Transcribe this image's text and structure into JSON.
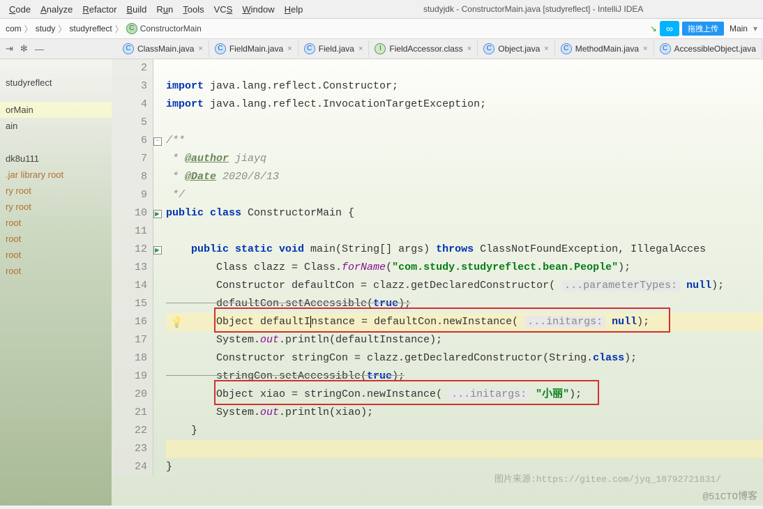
{
  "menu": {
    "items": [
      "Code",
      "Analyze",
      "Refactor",
      "Build",
      "Run",
      "Tools",
      "VCS",
      "Window",
      "Help"
    ],
    "underlines": [
      "C",
      "A",
      "R",
      "B",
      "R",
      "T",
      "V",
      "W",
      "H"
    ]
  },
  "title": "studyjdk - ConstructorMain.java [studyreflect] - IntelliJ IDEA",
  "crumbs": [
    "com",
    "study",
    "studyreflect",
    "ConstructorMain"
  ],
  "crumbs_file_icon": "C",
  "upload_label": "拖拽上传",
  "right_combo": "Main",
  "tabs": [
    {
      "icon": "C",
      "cls": "fc",
      "label": "ClassMain.java"
    },
    {
      "icon": "C",
      "cls": "fc",
      "label": "FieldMain.java"
    },
    {
      "icon": "C",
      "cls": "fc",
      "label": "Field.java"
    },
    {
      "icon": "I",
      "cls": "fi",
      "label": "FieldAccessor.class"
    },
    {
      "icon": "C",
      "cls": "fc",
      "label": "Object.java"
    },
    {
      "icon": "C",
      "cls": "fc",
      "label": "MethodMain.java"
    },
    {
      "icon": "C",
      "cls": "fc",
      "label": "AccessibleObject.java"
    }
  ],
  "sidebar": {
    "items": [
      "",
      "",
      "studyreflect",
      "",
      "",
      "orMain",
      "ain",
      "",
      "",
      "",
      "dk8u111",
      ".jar library root",
      "ry root",
      "ry root",
      " root",
      " root",
      " root",
      "root"
    ]
  },
  "gutter_start": 2,
  "gutter_end": 24,
  "code": {
    "l2": "",
    "l3a": "import",
    "l3b": " java.lang.reflect.Constructor;",
    "l4a": "import",
    "l4b": " java.lang.reflect.InvocationTargetException;",
    "l5": "",
    "l6": "/**",
    "l7a": " * ",
    "l7tag": "@author",
    "l7b": " jiayq",
    "l8a": " * ",
    "l8tag": "@Date",
    "l8b": " 2020/8/13",
    "l9": " */",
    "l10a": "public class",
    "l10b": " ConstructorMain {",
    "l11": "",
    "l12a": "    public static void",
    "l12b": " main(String[] args) ",
    "l12c": "throws",
    "l12d": " ClassNotFoundException, IllegalAcces",
    "l13a": "        Class clazz = Class.",
    "l13b": "forName",
    "l13c": "(",
    "l13s": "\"com.study.studyreflect.bean.People\"",
    "l13d": ");",
    "l14a": "        Constructor defaultCon = clazz.getDeclaredConstructor( ",
    "l14h": "...parameterTypes:",
    "l14b": " ",
    "l14n": "null",
    "l14c": ");",
    "l15a": "        defaultCon.setAccessible(",
    "l15b": "true",
    "l15c": ");",
    "l16a": "        Object defaultI",
    "l16b": "nstance = defaultCon.newInstance( ",
    "l16h": "...initargs:",
    "l16c": " ",
    "l16n": "null",
    "l16d": ");",
    "l17a": "        System.",
    "l17b": "out",
    "l17c": ".println(defaultInstance);",
    "l18": "        Constructor stringCon = clazz.getDeclaredConstructor(String.",
    "l18b": "class",
    "l18c": ");",
    "l19a": "        stringCon.setAccessible(",
    "l19b": "true",
    "l19c": ");",
    "l20a": "        Object xiao = stringCon.newInstance( ",
    "l20h": "...initargs:",
    "l20b": " ",
    "l20s": "\"小丽\"",
    "l20c": ");",
    "l21a": "        System.",
    "l21b": "out",
    "l21c": ".println(xiao);",
    "l22": "    }",
    "l23": "",
    "l24": "}"
  },
  "watermark": "@51CTO博客",
  "srcmark": "图片来源:https://gitee.com/jyq_18792721831/"
}
